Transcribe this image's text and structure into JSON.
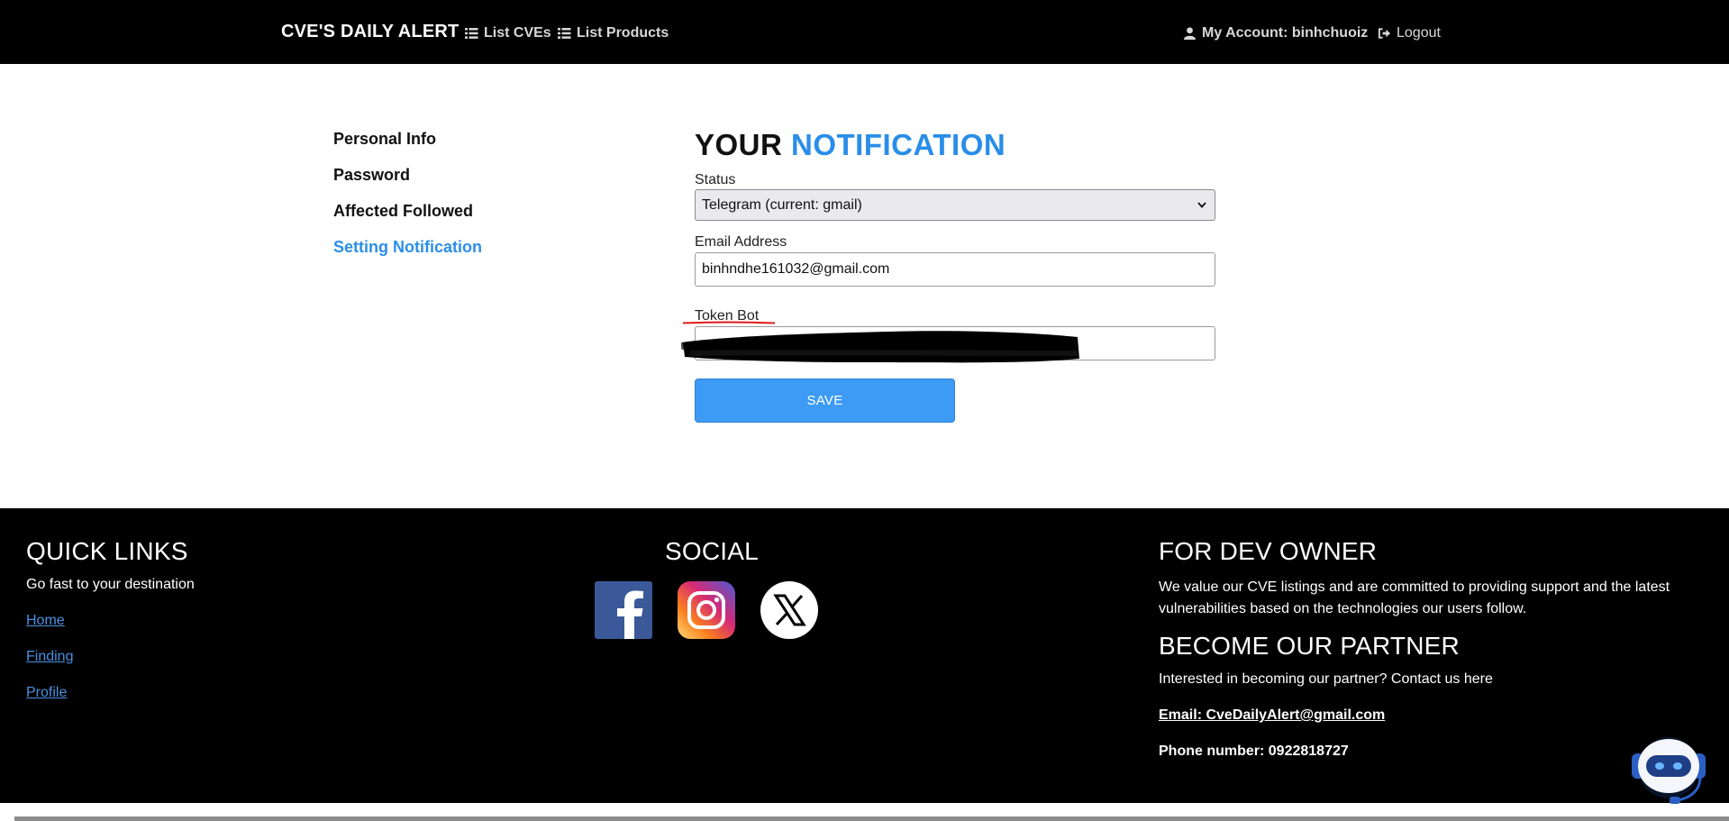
{
  "navbar": {
    "brand": "CVE'S DAILY ALERT",
    "links": [
      {
        "label": "List CVEs",
        "icon": "list-icon"
      },
      {
        "label": "List Products",
        "icon": "list-icon"
      }
    ],
    "account_label": "My Account: binhchuoiz",
    "logout_label": "Logout"
  },
  "sidebar": {
    "items": [
      {
        "label": "Personal Info"
      },
      {
        "label": "Password"
      },
      {
        "label": "Affected Followed"
      },
      {
        "label": "Setting Notification",
        "active": true
      }
    ]
  },
  "form": {
    "title_part1": "YOUR",
    "title_part2": "NOTIFICATION",
    "status_label": "Status",
    "status_value": "Telegram (current: gmail)",
    "email_label": "Email Address",
    "email_value": "binhndhe161032@gmail.com",
    "token_label": "Token Bot",
    "token_value": "",
    "save_label": "SAVE"
  },
  "footer": {
    "quick_links": {
      "title": "QUICK LINKS",
      "subtitle": "Go fast to your destination",
      "links": [
        "Home",
        "Finding",
        "Profile"
      ]
    },
    "social": {
      "title": "SOCIAL",
      "icons": [
        "facebook-icon",
        "instagram-icon",
        "x-icon"
      ]
    },
    "dev_owner": {
      "title": "FOR DEV OWNER",
      "text": "We value our CVE listings and are committed to providing support and the latest vulnerabilities based on the technologies our users follow."
    },
    "partner": {
      "title": "BECOME OUR PARTNER",
      "text": "Interested in becoming our partner? Contact us here",
      "email": "Email: CveDailyAlert@gmail.com",
      "phone": "Phone number: 0922818727"
    }
  },
  "colors": {
    "accent": "#2a8ee8",
    "button": "#3d9bf5",
    "navbar_bg": "#000000",
    "footer_bg": "#000000"
  }
}
